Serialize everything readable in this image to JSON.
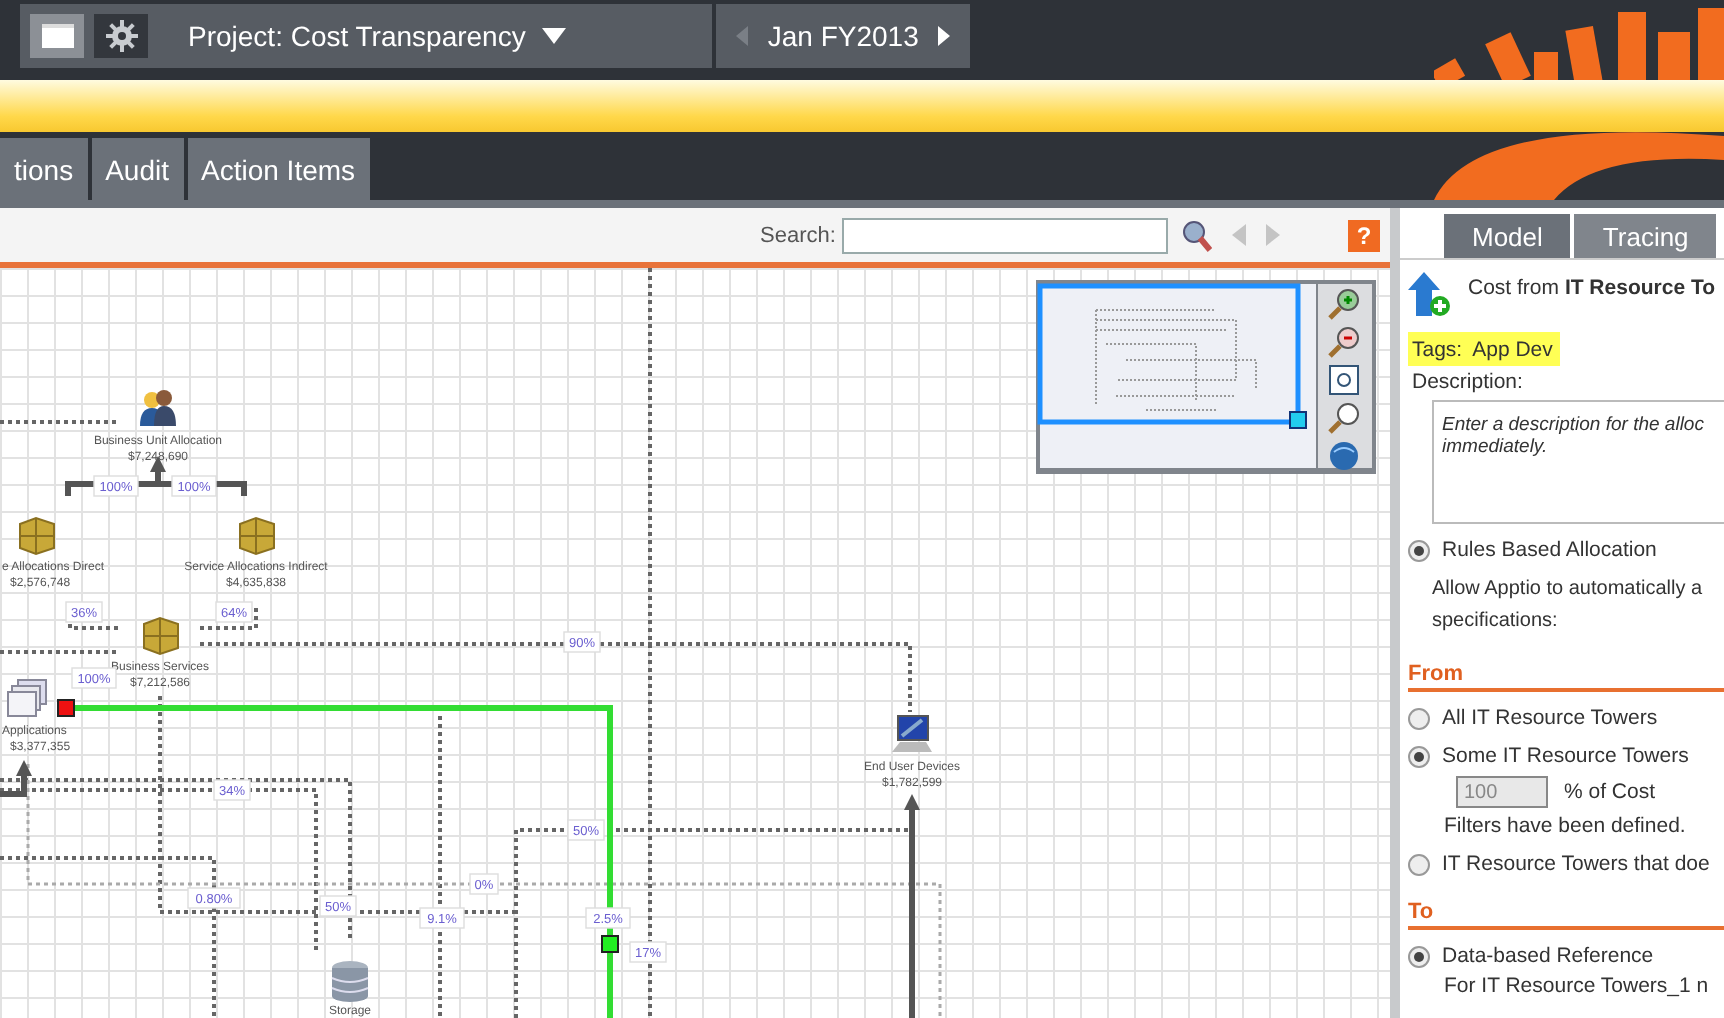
{
  "header": {
    "buttons": [
      {
        "kind": "window",
        "selected": true
      },
      {
        "kind": "settings",
        "selected": false
      }
    ],
    "project": "Project: Cost Transparency",
    "period": "Jan FY2013"
  },
  "tabs": [
    {
      "label": "tions",
      "selected": false
    },
    {
      "label": "Audit",
      "selected": false
    },
    {
      "label": "Action Items",
      "selected": false
    }
  ],
  "toolbar": {
    "search_label": "Search:",
    "help": "?"
  },
  "diagram": {
    "nodes": [
      {
        "kind": "people",
        "name": "Business Unit Allocation",
        "amount": "$7,248,690"
      },
      {
        "kind": "cube",
        "name": "e Allocations Direct",
        "amount": "$2,576,748"
      },
      {
        "kind": "cube",
        "name": "Service Allocations Indirect",
        "amount": "$4,635,838"
      },
      {
        "kind": "cube",
        "name": "Business Services",
        "amount": "$7,212,586"
      },
      {
        "kind": "windows",
        "name": "Applications",
        "amount": "$3,377,355"
      },
      {
        "kind": "monitor",
        "name": "End User Devices",
        "amount": "$1,782,599"
      },
      {
        "kind": "database",
        "name": "Storage"
      }
    ],
    "percentages": [
      "100%",
      "100%",
      "36%",
      "64%",
      "90%",
      "100%",
      "34%",
      "50%",
      "0%",
      "0.80%",
      "50%",
      "9.1%",
      "2.5%",
      "17%"
    ]
  },
  "panel": {
    "tabs": [
      {
        "label": "Model",
        "selected": true
      },
      {
        "label": "Tracing",
        "selected": false
      }
    ],
    "heading": "Cost from **IT Resource To**",
    "tags": {
      "label": "Tags:",
      "value": "App Dev",
      "highlighted": true
    },
    "description": {
      "label": "Description:",
      "placeholder": "Enter a description for the alloc immediately."
    },
    "items": [
      {
        "kind": "radio",
        "label": "Rules Based Allocation",
        "selected": true
      },
      {
        "kind": "text",
        "text": "Allow Apptio to automatically a specifications:"
      },
      {
        "kind": "section",
        "label": "From"
      },
      {
        "kind": "radio",
        "label": "All IT Resource Towers",
        "selected": false
      },
      {
        "kind": "radio",
        "label": "Some IT Resource Towers",
        "selected": true
      },
      {
        "kind": "percent",
        "value": "100",
        "unit": "% of Cost",
        "disabled": true
      },
      {
        "kind": "note",
        "text": "Filters have been defined."
      },
      {
        "kind": "radio",
        "label": "IT Resource Towers that doe",
        "selected": false
      },
      {
        "kind": "section",
        "label": "To"
      },
      {
        "kind": "radio",
        "label": "Data-based Reference",
        "selected": true
      },
      {
        "kind": "note",
        "text": "For IT Resource Towers_1 n"
      }
    ]
  }
}
